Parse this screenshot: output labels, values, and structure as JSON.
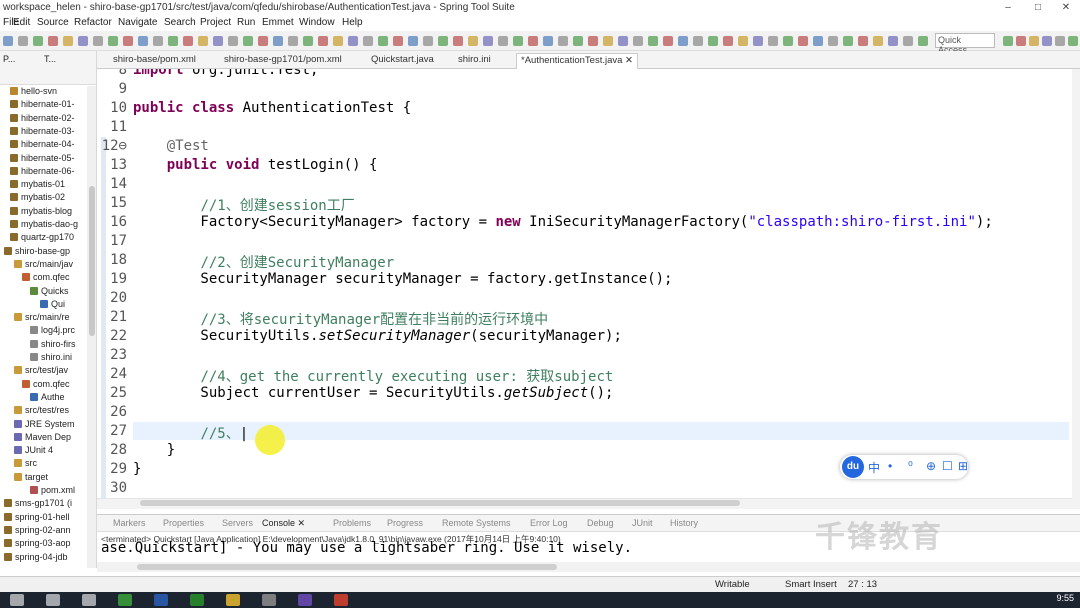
{
  "window": {
    "title": "workspace_helen - shiro-base-gp1701/src/test/java/com/qfedu/shirobase/AuthenticationTest.java - Spring Tool Suite",
    "minimize": "–",
    "maximize": "□",
    "close": "✕"
  },
  "menu": [
    "File",
    "Edit",
    "Source",
    "Refactor",
    "Navigate",
    "Search",
    "Project",
    "Run",
    "Emmet",
    "Window",
    "Help"
  ],
  "quick_access": "Quick Access",
  "sidebar": {
    "header": "P...",
    "header2": "T...",
    "items": [
      {
        "label": "hello-svn",
        "color": "#b8862e"
      },
      {
        "label": "hibernate-01-",
        "color": "#8a6a2a"
      },
      {
        "label": "hibernate-02-",
        "color": "#8a6a2a"
      },
      {
        "label": "hibernate-03-",
        "color": "#8a6a2a"
      },
      {
        "label": "hibernate-04-",
        "color": "#8a6a2a"
      },
      {
        "label": "hibernate-05-",
        "color": "#8a6a2a"
      },
      {
        "label": "hibernate-06-",
        "color": "#8a6a2a"
      },
      {
        "label": "mybatis-01",
        "color": "#8a6a2a"
      },
      {
        "label": "mybatis-02",
        "color": "#8a6a2a"
      },
      {
        "label": "mybatis-blog",
        "color": "#8a6a2a"
      },
      {
        "label": "mybatis-dao-g",
        "color": "#8a6a2a"
      },
      {
        "label": "quartz-gp170",
        "color": "#8a6a2a"
      },
      {
        "label": "shiro-base-gp",
        "color": "#8a6a2a"
      },
      {
        "label": "src/main/jav",
        "color": "#c79b3a"
      },
      {
        "label": "com.qfec",
        "color": "#c06030"
      },
      {
        "label": "Quicks",
        "color": "#5a8a3a"
      },
      {
        "label": "Qui",
        "color": "#3a6ab0"
      },
      {
        "label": "src/main/re",
        "color": "#c79b3a"
      },
      {
        "label": "log4j.prc",
        "color": "#888"
      },
      {
        "label": "shiro-firs",
        "color": "#888"
      },
      {
        "label": "shiro.ini",
        "color": "#888"
      },
      {
        "label": "src/test/jav",
        "color": "#c79b3a"
      },
      {
        "label": "com.qfec",
        "color": "#c06030"
      },
      {
        "label": "Authe",
        "color": "#3a6ab0"
      },
      {
        "label": "src/test/res",
        "color": "#c79b3a"
      },
      {
        "label": "JRE System",
        "color": "#6a6ab0"
      },
      {
        "label": "Maven Dep",
        "color": "#6a6ab0"
      },
      {
        "label": "JUnit 4",
        "color": "#6a6ab0"
      },
      {
        "label": "src",
        "color": "#c79b3a"
      },
      {
        "label": "target",
        "color": "#c79b3a"
      },
      {
        "label": "pom.xml",
        "color": "#b05050"
      },
      {
        "label": "sms-gp1701 (i",
        "color": "#8a6a2a"
      },
      {
        "label": "spring-01-hell",
        "color": "#8a6a2a"
      },
      {
        "label": "spring-02-ann",
        "color": "#8a6a2a"
      },
      {
        "label": "spring-03-aop",
        "color": "#8a6a2a"
      },
      {
        "label": "spring-04-jdb",
        "color": "#8a6a2a"
      }
    ]
  },
  "tabs": [
    {
      "label": "shiro-base/pom.xml",
      "active": false
    },
    {
      "label": "shiro-base-gp1701/pom.xml",
      "active": false
    },
    {
      "label": "Quickstart.java",
      "active": false
    },
    {
      "label": "shiro.ini",
      "active": false
    },
    {
      "label": "*AuthenticationTest.java ✕",
      "active": true
    }
  ],
  "editor": {
    "lines": [
      {
        "n": "8",
        "html": "<span class=\"kw\">import</span> org.junit.Test;"
      },
      {
        "n": "9",
        "html": ""
      },
      {
        "n": "10",
        "html": "<span class=\"kw\">public class</span> AuthenticationTest {"
      },
      {
        "n": "11",
        "html": ""
      },
      {
        "n": "12⊖",
        "html": "    <span class=\"an\">@Test</span>"
      },
      {
        "n": "13",
        "html": "    <span class=\"kw\">public void</span> testLogin() {"
      },
      {
        "n": "14",
        "html": ""
      },
      {
        "n": "15",
        "html": "        <span class=\"cm\">//1、创建session工厂</span>"
      },
      {
        "n": "16",
        "html": "        Factory&lt;SecurityManager&gt; factory = <span class=\"kw\">new</span> IniSecurityManagerFactory(<span class=\"st\">\"classpath:shiro-first.ini\"</span>);"
      },
      {
        "n": "17",
        "html": ""
      },
      {
        "n": "18",
        "html": "        <span class=\"cm\">//2、创建SecurityManager</span>"
      },
      {
        "n": "19",
        "html": "        SecurityManager securityManager = factory.getInstance();"
      },
      {
        "n": "20",
        "html": ""
      },
      {
        "n": "21",
        "html": "        <span class=\"cm\">//3、将securityManager配置在非当前的运行环境中</span>"
      },
      {
        "n": "22",
        "html": "        SecurityUtils.<span class=\"it\">setSecurityManager</span>(securityManager);"
      },
      {
        "n": "23",
        "html": ""
      },
      {
        "n": "24",
        "html": "        <span class=\"cm\">//4、get the currently executing user: 获取subject</span>"
      },
      {
        "n": "25",
        "html": "        Subject currentUser = SecurityUtils.<span class=\"it\">getSubject</span>();"
      },
      {
        "n": "26",
        "html": ""
      },
      {
        "n": "27",
        "html": "        <span class=\"cm\">//5、</span>|"
      },
      {
        "n": "28",
        "html": "    }"
      },
      {
        "n": "29",
        "html": "}"
      },
      {
        "n": "30",
        "html": ""
      }
    ]
  },
  "ime": {
    "logo": "du",
    "glyphs": [
      "中",
      "•",
      "⁰",
      "⊕",
      "☐",
      "⊞"
    ]
  },
  "console_tabs": [
    {
      "label": "Markers",
      "active": false
    },
    {
      "label": "Properties",
      "active": false
    },
    {
      "label": "Servers",
      "active": false
    },
    {
      "label": "Console ✕",
      "active": true
    },
    {
      "label": "Problems",
      "active": false
    },
    {
      "label": "Progress",
      "active": false
    },
    {
      "label": "Remote Systems",
      "active": false
    },
    {
      "label": "Error Log",
      "active": false
    },
    {
      "label": "Debug",
      "active": false
    },
    {
      "label": "JUnit",
      "active": false
    },
    {
      "label": "History",
      "active": false
    }
  ],
  "console": {
    "terminated": "<terminated> Quickstart [Java Application] E:\\development\\Java\\jdk1.8.0_91\\bin\\javaw.exe (2017年10月14日 上午9:40:10)",
    "output": "ase.Quickstart] - You may use a lightsaber ring.  Use it wisely."
  },
  "status": {
    "mode": "Writable",
    "insert": "Smart Insert",
    "position": "27 : 13"
  },
  "watermark": "千锋教育",
  "clock": "9:55"
}
